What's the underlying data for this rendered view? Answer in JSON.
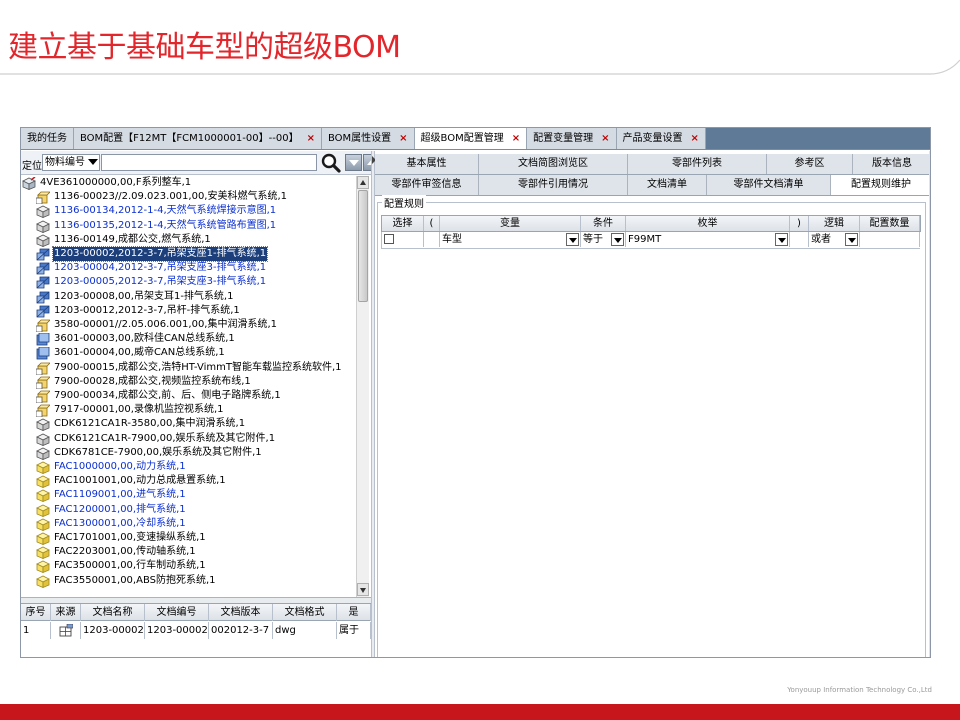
{
  "slide": {
    "title": "建立基于基础车型的超级BOM",
    "footer": "Yonyouup Information  Technology Co.,Ltd",
    "accent_color": "#e2262b",
    "footer_bar_color": "#c8161d"
  },
  "tabs": [
    {
      "label": "我的任务",
      "closable": false,
      "active": false
    },
    {
      "label": "BOM配置【F12MT【FCM1000001-00】--00】",
      "closable": true,
      "active": false
    },
    {
      "label": "BOM属性设置",
      "closable": true,
      "active": false
    },
    {
      "label": "超级BOM配置管理",
      "closable": true,
      "active": true
    },
    {
      "label": "配置变量管理",
      "closable": true,
      "active": false
    },
    {
      "label": "产品变量设置",
      "closable": true,
      "active": false
    }
  ],
  "close_glyph": "×",
  "search": {
    "label": "定位",
    "field": "物料编号",
    "value": "",
    "buttons": [
      "search-icon",
      "page-down-icon",
      "page-up-icon"
    ]
  },
  "tree": [
    {
      "text": "4VE361000000,00,F系列整车,1",
      "icon": "assembly-icon",
      "color": "black",
      "indent": 0
    },
    {
      "text": "1136-00023//2.09.023.001,00,安美科燃气系统,1",
      "icon": "doc-part-icon",
      "color": "black",
      "indent": 1
    },
    {
      "text": "1136-00134,2012-1-4,天然气系统焊接示意图,1",
      "icon": "part-icon",
      "color": "blue",
      "indent": 1
    },
    {
      "text": "1136-00135,2012-1-4,天然气系统管路布置图,1",
      "icon": "part-icon",
      "color": "blue",
      "indent": 1
    },
    {
      "text": "1136-00149,成都公交,燃气系统,1",
      "icon": "part-icon",
      "color": "black",
      "indent": 1
    },
    {
      "text": "1203-00002,2012-3-7,吊架支座1-排气系统,1",
      "icon": "blue-part-icon",
      "color": "selected",
      "indent": 1
    },
    {
      "text": "1203-00004,2012-3-7,吊架支座3-排气系统,1",
      "icon": "blue-part-icon",
      "color": "blue",
      "indent": 1
    },
    {
      "text": "1203-00005,2012-3-7,吊架支座3-排气系统,1",
      "icon": "blue-part-icon",
      "color": "blue",
      "indent": 1
    },
    {
      "text": "1203-00008,00,吊架支耳1-排气系统,1",
      "icon": "blue-part-icon",
      "color": "black",
      "indent": 1
    },
    {
      "text": "1203-00012,2012-3-7,吊杆-排气系统,1",
      "icon": "blue-part-icon",
      "color": "black",
      "indent": 1
    },
    {
      "text": "3580-00001//2.05.006.001,00,集中润滑系统,1",
      "icon": "doc-part-icon",
      "color": "black",
      "indent": 1
    },
    {
      "text": "3601-00003,00,欧科佳CAN总线系统,1",
      "icon": "blue-doc-icon",
      "color": "black",
      "indent": 1
    },
    {
      "text": "3601-00004,00,威帝CAN总线系统,1",
      "icon": "blue-doc-icon",
      "color": "black",
      "indent": 1
    },
    {
      "text": "7900-00015,成都公交,浩特HT-VimmT智能车载监控系统软件,1",
      "icon": "doc-part-icon",
      "color": "black",
      "indent": 1
    },
    {
      "text": "7900-00028,成都公交,视频监控系统布线,1",
      "icon": "doc-part-icon",
      "color": "black",
      "indent": 1
    },
    {
      "text": "7900-00034,成都公交,前、后、侧电子路牌系统,1",
      "icon": "doc-part-icon",
      "color": "black",
      "indent": 1
    },
    {
      "text": "7917-00001,00,录像机监控视系统,1",
      "icon": "doc-part-icon",
      "color": "black",
      "indent": 1
    },
    {
      "text": "CDK6121CA1R-3580,00,集中润滑系统,1",
      "icon": "part-icon",
      "color": "black",
      "indent": 1
    },
    {
      "text": "CDK6121CA1R-7900,00,娱乐系统及其它附件,1",
      "icon": "part-icon",
      "color": "black",
      "indent": 1
    },
    {
      "text": "CDK6781CE-7900,00,娱乐系统及其它附件,1",
      "icon": "part-icon",
      "color": "black",
      "indent": 1
    },
    {
      "text": "FAC1000000,00,动力系统,1",
      "icon": "yellow-part-icon",
      "color": "blue",
      "indent": 1
    },
    {
      "text": "FAC1001001,00,动力总成悬置系统,1",
      "icon": "yellow-part-icon",
      "color": "black",
      "indent": 1
    },
    {
      "text": "FAC1109001,00,进气系统,1",
      "icon": "yellow-part-icon",
      "color": "blue",
      "indent": 1
    },
    {
      "text": "FAC1200001,00,排气系统,1",
      "icon": "yellow-part-icon",
      "color": "blue",
      "indent": 1
    },
    {
      "text": "FAC1300001,00,冷却系统,1",
      "icon": "yellow-part-icon",
      "color": "blue",
      "indent": 1
    },
    {
      "text": "FAC1701001,00,变速操纵系统,1",
      "icon": "yellow-part-icon",
      "color": "black",
      "indent": 1
    },
    {
      "text": "FAC2203001,00,传动轴系统,1",
      "icon": "yellow-part-icon",
      "color": "black",
      "indent": 1
    },
    {
      "text": "FAC3500001,00,行车制动系统,1",
      "icon": "yellow-part-icon",
      "color": "black",
      "indent": 1
    },
    {
      "text": "FAC3550001,00,ABS防抱死系统,1",
      "icon": "yellow-part-icon",
      "color": "black",
      "indent": 1
    }
  ],
  "doc_table": {
    "headers": [
      "序号",
      "来源",
      "文档名称",
      "文档编号",
      "文档版本",
      "文档格式",
      "是"
    ],
    "rows": [
      [
        "1",
        "",
        "1203-00002",
        "1203-00002",
        "002012-3-7",
        "dwg",
        "属于"
      ]
    ]
  },
  "subtabs_top": [
    {
      "label": "基本属性",
      "active": false
    },
    {
      "label": "文档简图浏览区",
      "active": false
    },
    {
      "label": "零部件列表",
      "active": false
    },
    {
      "label": "参考区",
      "active": false
    },
    {
      "label": "版本信息",
      "active": false
    }
  ],
  "subtabs_bottom": [
    {
      "label": "零部件审签信息",
      "active": false
    },
    {
      "label": "零部件引用情况",
      "active": false
    },
    {
      "label": "文档清单",
      "active": false
    },
    {
      "label": "零部件文档清单",
      "active": false
    },
    {
      "label": "配置规则维护",
      "active": true
    }
  ],
  "rules": {
    "group_title": "配置规则",
    "headers": [
      "选择",
      "(",
      "变量",
      "条件",
      "枚举",
      ")",
      "逻辑",
      "配置数量"
    ],
    "rows": [
      {
        "selected": false,
        "open_paren": "",
        "variable": "车型",
        "condition": "等于",
        "enum": "F99MT",
        "close_paren": "",
        "logic": "或者",
        "quantity": ""
      }
    ]
  }
}
